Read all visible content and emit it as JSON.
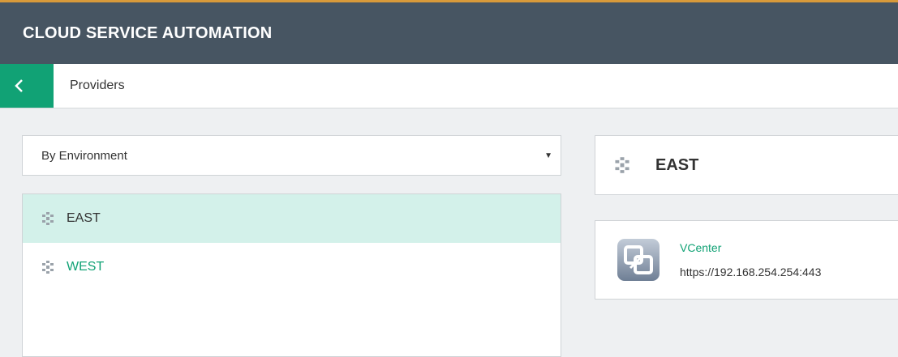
{
  "header": {
    "title": "CLOUD SERVICE AUTOMATION"
  },
  "subbar": {
    "breadcrumb": "Providers"
  },
  "filter": {
    "selected": "By Environment"
  },
  "environments": [
    {
      "label": "EAST",
      "selected": true
    },
    {
      "label": "WEST",
      "selected": false
    }
  ],
  "detail": {
    "environment_name": "EAST",
    "provider": {
      "name": "VCenter",
      "url": "https://192.168.254.254:443"
    }
  },
  "colors": {
    "header_bg": "#475562",
    "accent_green": "#11a275",
    "selected_row": "#d3f1ea",
    "top_accent": "#d89a3a"
  },
  "icons": {
    "back": "chevron-left-icon",
    "environment": "environment-cluster-icon",
    "provider": "vcenter-logo-icon"
  }
}
